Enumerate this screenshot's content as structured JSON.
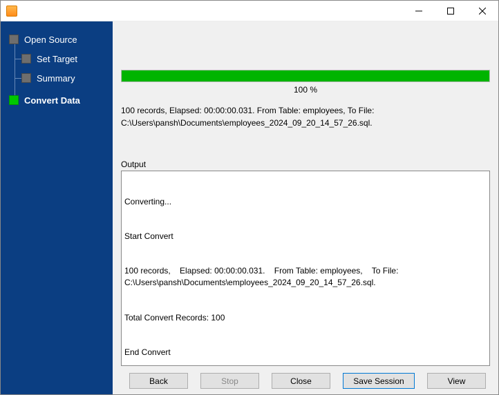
{
  "sidebar": {
    "items": [
      {
        "label": "Open Source",
        "active": false,
        "child": false
      },
      {
        "label": "Set Target",
        "active": false,
        "child": true
      },
      {
        "label": "Summary",
        "active": false,
        "child": true
      },
      {
        "label": "Convert Data",
        "active": true,
        "child": false
      }
    ]
  },
  "progress": {
    "percent": 100,
    "label": "100 %"
  },
  "summary": {
    "line1": "100 records,    Elapsed: 00:00:00.031.    From Table: employees,    To File:",
    "line2": "C:\\Users\\pansh\\Documents\\employees_2024_09_20_14_57_26.sql."
  },
  "output": {
    "label": "Output",
    "lines": [
      "Converting...",
      "Start Convert",
      "100 records,    Elapsed: 00:00:00.031.    From Table: employees,    To File: C:\\Users\\pansh\\Documents\\employees_2024_09_20_14_57_26.sql.",
      "Total Convert Records: 100",
      "End Convert"
    ]
  },
  "buttons": {
    "back": "Back",
    "stop": "Stop",
    "close": "Close",
    "save_session": "Save Session",
    "view": "View"
  }
}
